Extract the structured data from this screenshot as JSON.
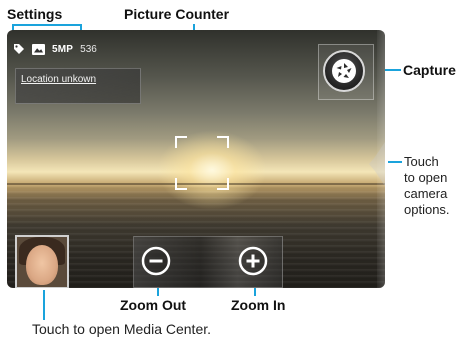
{
  "callouts": {
    "settings": "Settings",
    "picture_counter": "Picture Counter",
    "capture": "Capture",
    "camera_options": "Touch\nto open\ncamera\noptions.",
    "zoom_out": "Zoom Out",
    "zoom_in": "Zoom In",
    "media_center": "Touch to open Media Center."
  },
  "status_bar": {
    "icons": [
      "tag-icon",
      "picture-icon"
    ],
    "resolution": "5MP",
    "picture_count": "536"
  },
  "location": {
    "text": "Location unkown"
  },
  "controls": {
    "capture_icon": "shutter-aperture-icon",
    "zoom_out_icon": "minus-circle-icon",
    "zoom_in_icon": "plus-circle-icon"
  },
  "colors": {
    "callout_line": "#1aa3dc"
  }
}
